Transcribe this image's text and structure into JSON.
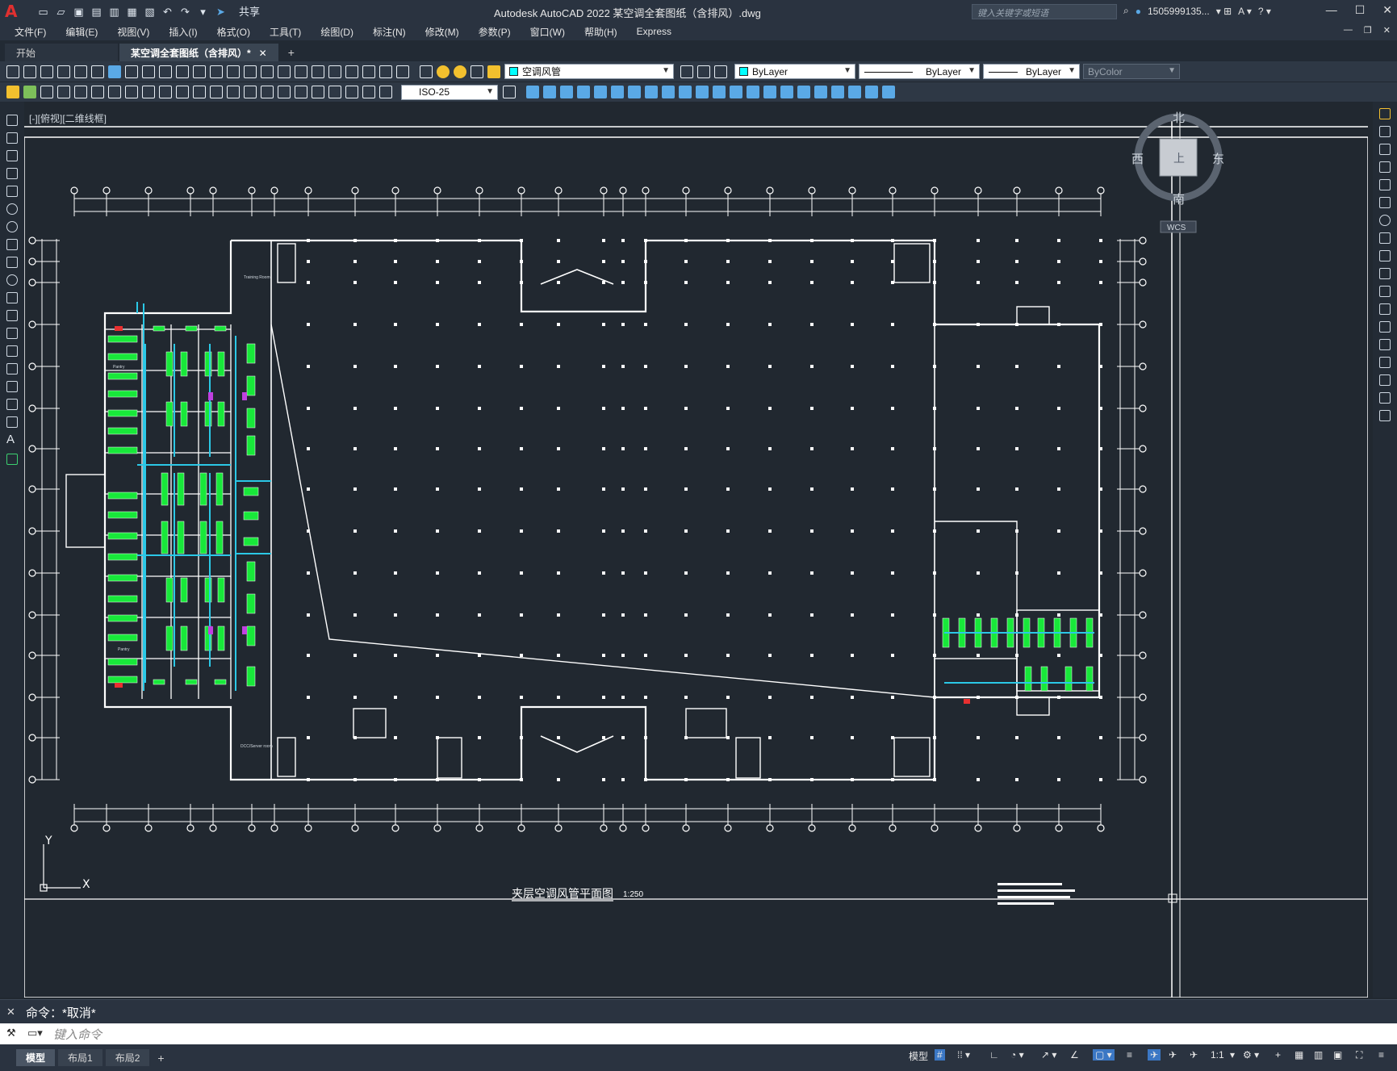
{
  "app": {
    "window_title": "Autodesk AutoCAD 2022    某空调全套图纸（含排风）.dwg",
    "search_placeholder": "键入关键字或短语",
    "user": "1505999135...",
    "share": "共享"
  },
  "menu": [
    "文件(F)",
    "编辑(E)",
    "视图(V)",
    "插入(I)",
    "格式(O)",
    "工具(T)",
    "绘图(D)",
    "标注(N)",
    "修改(M)",
    "参数(P)",
    "窗口(W)",
    "帮助(H)",
    "Express"
  ],
  "tabs": [
    {
      "label": "开始",
      "active": false
    },
    {
      "label": "某空调全套图纸（含排风）*",
      "active": true
    }
  ],
  "toolbar": {
    "layer": "空调风管",
    "color": "ByLayer",
    "linetype": "ByLayer",
    "lineweight": "ByLayer",
    "plotstyle": "ByColor",
    "dimstyle": "ISO-25",
    "layer_color": "#00ffff"
  },
  "viewport": {
    "label": "[-][俯视][二维线框]",
    "compass": {
      "north": "北",
      "south": "南",
      "east": "东",
      "west": "西",
      "top": "上",
      "wcs": "WCS"
    },
    "ucs": {
      "x": "X",
      "y": "Y"
    }
  },
  "drawing": {
    "title": "夹层空调风管平面图",
    "scale": "1:250",
    "labels": [
      "Training Room",
      "Pantry",
      "Pantry",
      "DCC/Server room"
    ]
  },
  "command": {
    "history": "命令：*取消*",
    "placeholder": "键入命令"
  },
  "layout_tabs": [
    "模型",
    "布局1",
    "布局2"
  ],
  "status": {
    "model": "模型",
    "scale": "1:1"
  }
}
